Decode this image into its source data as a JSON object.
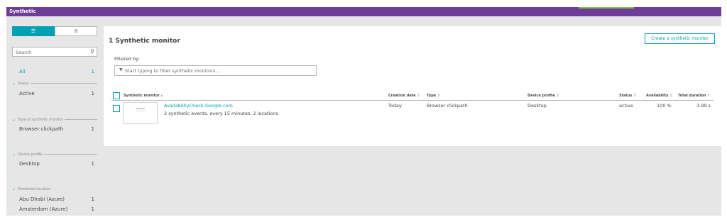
{
  "app": {
    "title": "Synthetic"
  },
  "sidebar": {
    "search_placeholder": "Search",
    "all": {
      "label": "All",
      "count": "1"
    },
    "facets": [
      {
        "header": "Status",
        "items": [
          {
            "label": "Active",
            "count": "1"
          }
        ]
      },
      {
        "header": "Type of synthetic monitor",
        "items": [
          {
            "label": "Browser clickpath",
            "count": "1"
          }
        ]
      },
      {
        "header": "Device profile",
        "items": [
          {
            "label": "Desktop",
            "count": "1"
          }
        ]
      },
      {
        "header": "Monitored location",
        "items": [
          {
            "label": "Abu Dhabi (Azure)",
            "count": "1"
          },
          {
            "label": "Amsterdam (Azure)",
            "count": "1"
          }
        ]
      }
    ]
  },
  "main": {
    "title": "1 Synthetic monitor",
    "create_button": "Create a synthetic monitor",
    "filtered_by": "Filtered by:",
    "filter_placeholder": "Start typing to filter synthetic monitors...",
    "columns": {
      "monitor": "Synthetic monitor",
      "creation": "Creation date",
      "type": "Type",
      "device": "Device profile",
      "status": "Status",
      "availability": "Availability",
      "duration": "Total duration"
    },
    "rows": [
      {
        "name": "AvailabilityCheck-Google.com",
        "details": "2 synthetic events, every 15 minutes, 2 locations",
        "creation": "Today",
        "type": "Browser clickpath",
        "device": "Desktop",
        "status": "active",
        "availability": "100 %",
        "duration": "3.99 s"
      }
    ]
  },
  "colors": {
    "brand": "#6d3d99",
    "accent": "#00a1b2",
    "highlight": "#7dc540"
  }
}
